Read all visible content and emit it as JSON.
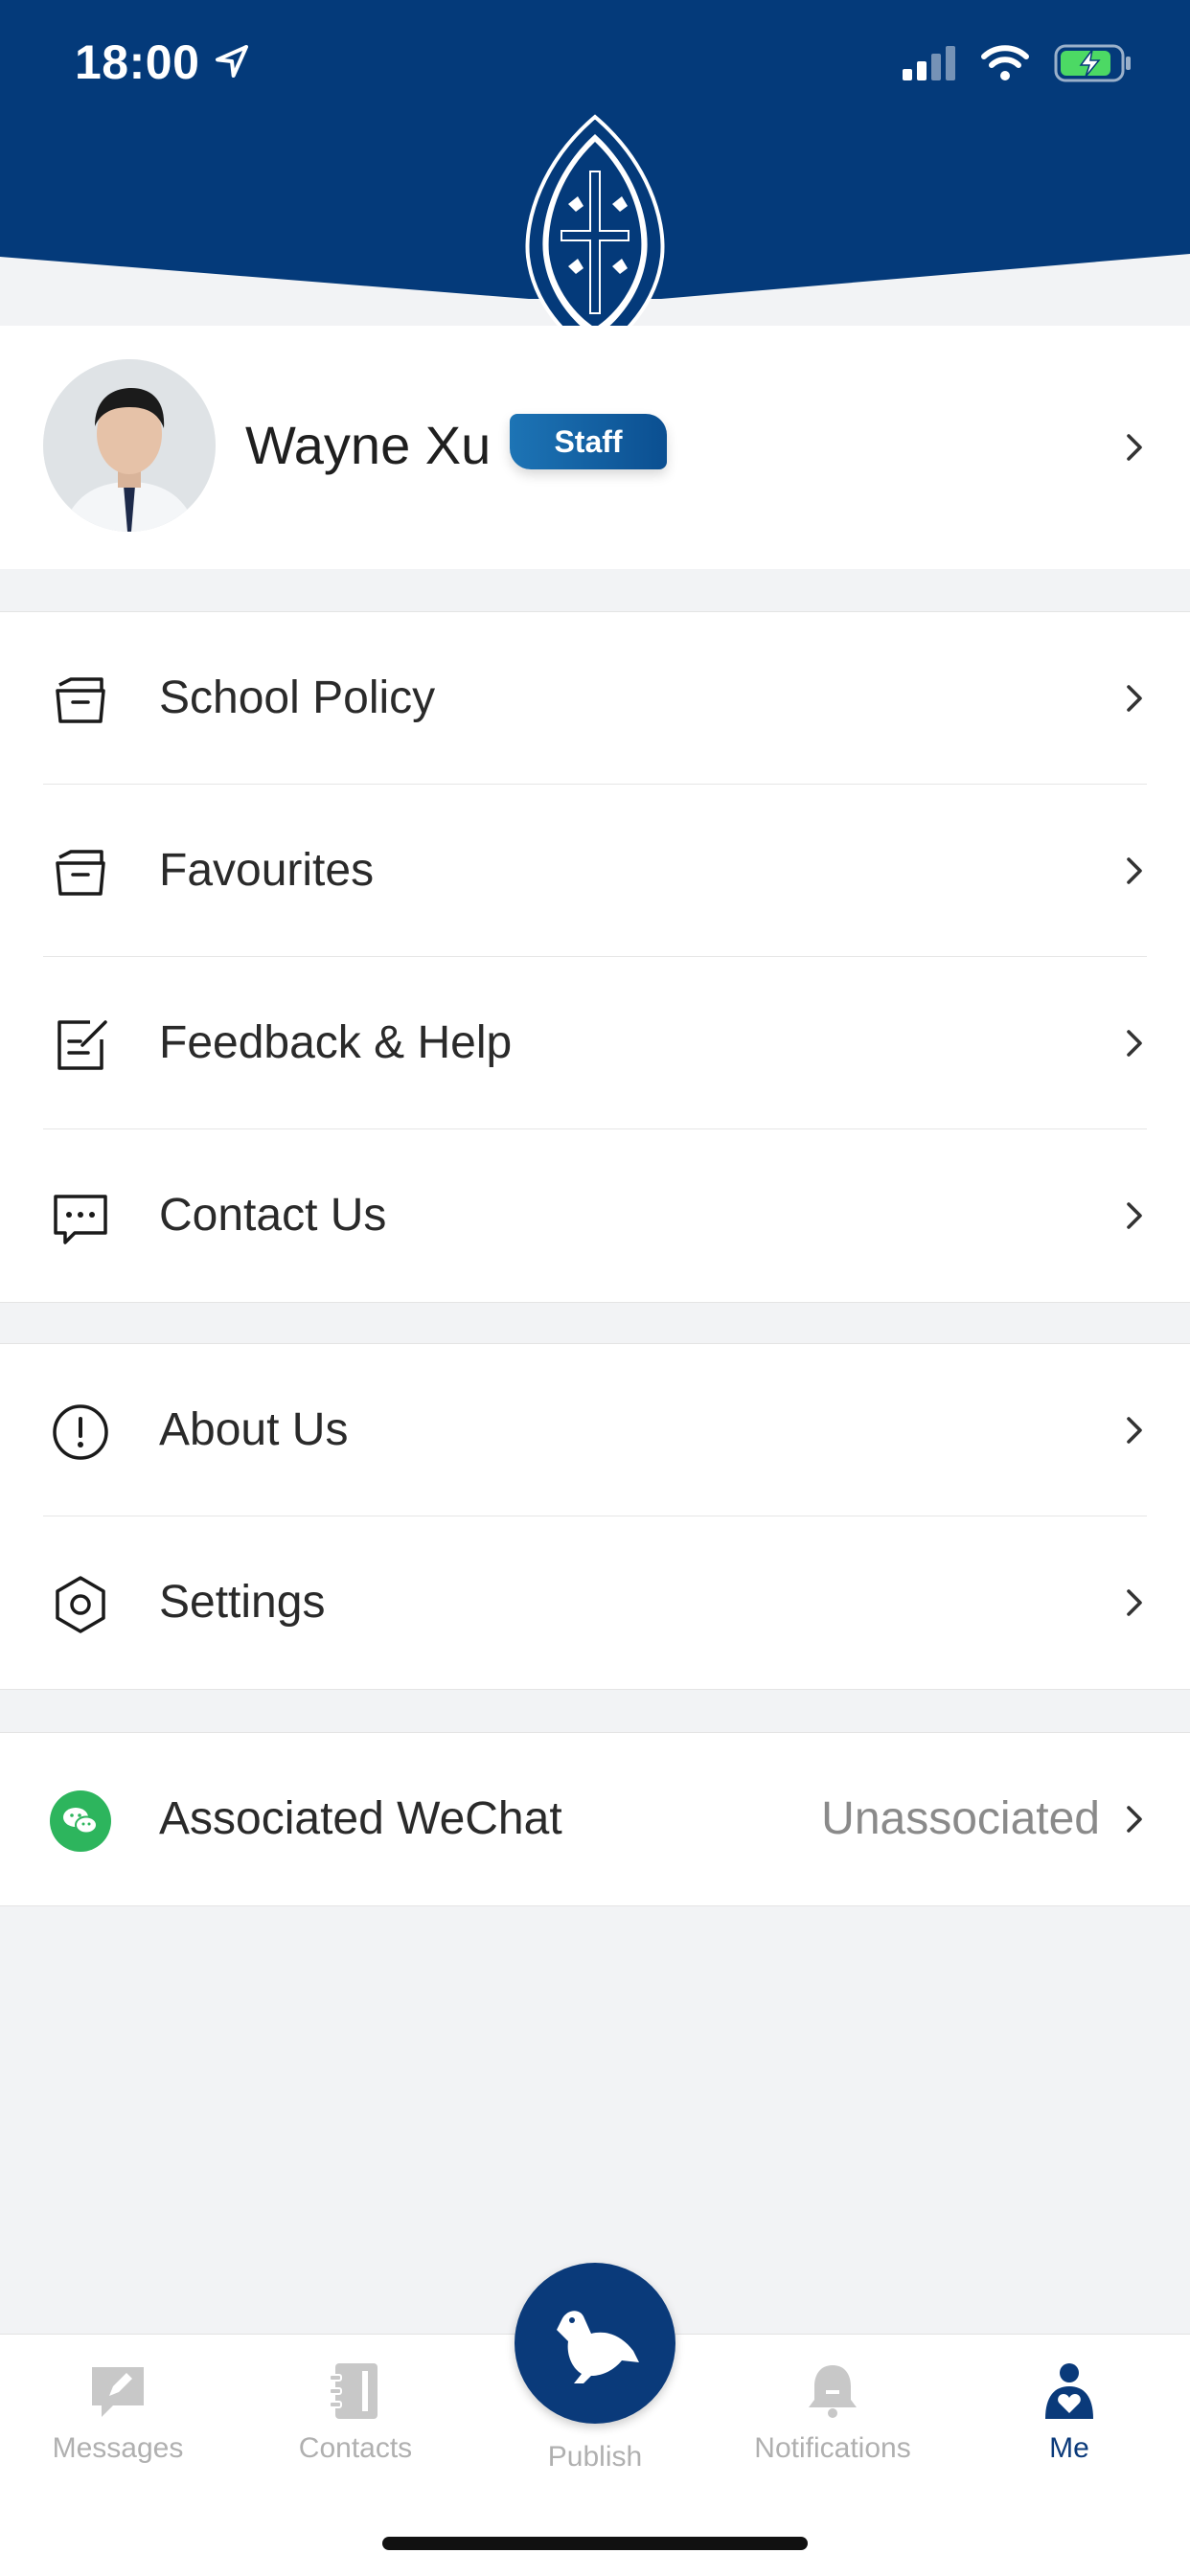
{
  "status_bar": {
    "time": "18:00"
  },
  "colors": {
    "brand": "#043a7a",
    "accent": "#1d74b5",
    "wechat": "#2db55d"
  },
  "profile": {
    "name": "Wayne Xu",
    "role_badge": "Staff"
  },
  "menu_group_1": [
    {
      "label": "School Policy",
      "icon": "folder-icon"
    },
    {
      "label": "Favourites",
      "icon": "folder-icon"
    },
    {
      "label": "Feedback & Help",
      "icon": "edit-note-icon"
    },
    {
      "label": "Contact Us",
      "icon": "chat-bubble-icon"
    }
  ],
  "menu_group_2": [
    {
      "label": "About Us",
      "icon": "info-exclamation-icon"
    },
    {
      "label": "Settings",
      "icon": "settings-hexagon-icon"
    }
  ],
  "menu_group_3": [
    {
      "label": "Associated WeChat",
      "value": "Unassociated",
      "icon": "wechat-icon"
    }
  ],
  "tabs": [
    {
      "label": "Messages",
      "icon": "message-icon"
    },
    {
      "label": "Contacts",
      "icon": "contacts-book-icon"
    },
    {
      "label": "Publish",
      "icon": "bird-icon"
    },
    {
      "label": "Notifications",
      "icon": "bell-icon"
    },
    {
      "label": "Me",
      "icon": "person-heart-icon",
      "active": true
    }
  ]
}
